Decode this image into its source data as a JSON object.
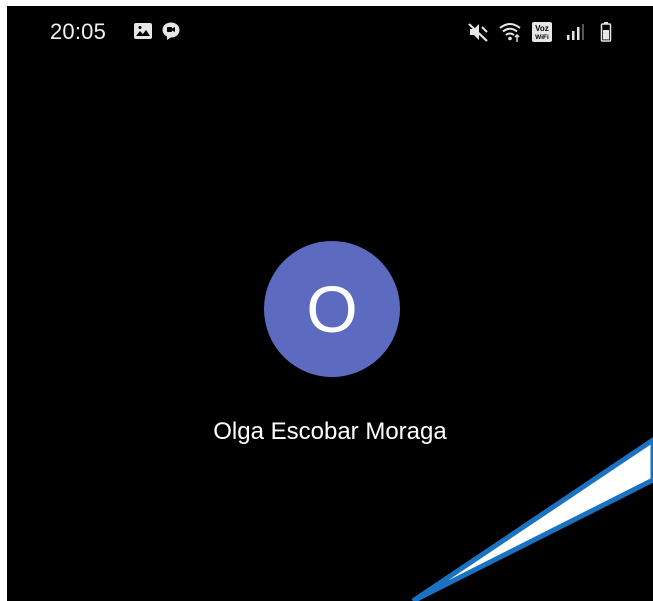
{
  "status_bar": {
    "time": "20:05",
    "left_icons": [
      "gallery-icon",
      "chat-icon"
    ],
    "right_icons": [
      "mute-icon",
      "wifi-icon",
      "voz-wifi-icon",
      "signal-icon",
      "battery-icon"
    ],
    "voz_wifi_label_top": "Voz",
    "voz_wifi_label_bottom": "WiFi"
  },
  "contact": {
    "avatar_initial": "O",
    "avatar_color": "#5c6bc0",
    "name": "Olga Escobar Moraga"
  },
  "annotation": {
    "pointer_fill": "#ffffff",
    "pointer_stroke": "#1a73c2"
  }
}
